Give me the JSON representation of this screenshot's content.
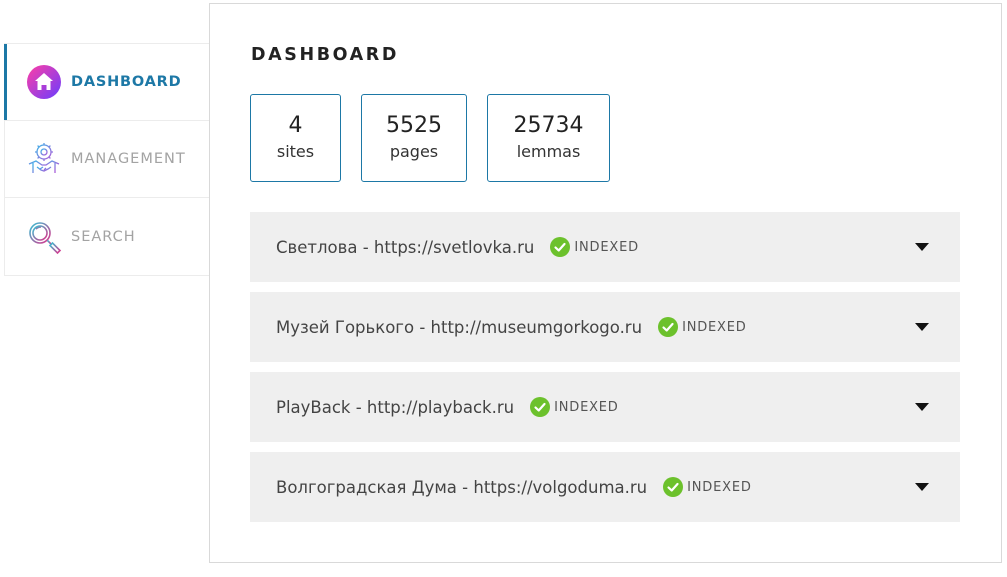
{
  "sidebar": {
    "items": [
      {
        "label": "DASHBOARD",
        "icon": "home-icon",
        "active": true
      },
      {
        "label": "MANAGEMENT",
        "icon": "gear-handshake-icon",
        "active": false
      },
      {
        "label": "SEARCH",
        "icon": "magnifier-icon",
        "active": false
      }
    ]
  },
  "main": {
    "title": "DASHBOARD",
    "stats": [
      {
        "value": "4",
        "label": "sites"
      },
      {
        "value": "5525",
        "label": "pages"
      },
      {
        "value": "25734",
        "label": "lemmas"
      }
    ],
    "sites": [
      {
        "name": "Светлова - https://svetlovka.ru",
        "status": "INDEXED"
      },
      {
        "name": "Музей Горького - http://museumgorkogo.ru",
        "status": "INDEXED"
      },
      {
        "name": "PlayBack - http://playback.ru",
        "status": "INDEXED"
      },
      {
        "name": "Волгоградская Дума - https://volgoduma.ru",
        "status": "INDEXED"
      }
    ]
  },
  "colors": {
    "accent": "#1d78a6",
    "indexed": "#6cc12c",
    "row_bg": "#efefef"
  }
}
